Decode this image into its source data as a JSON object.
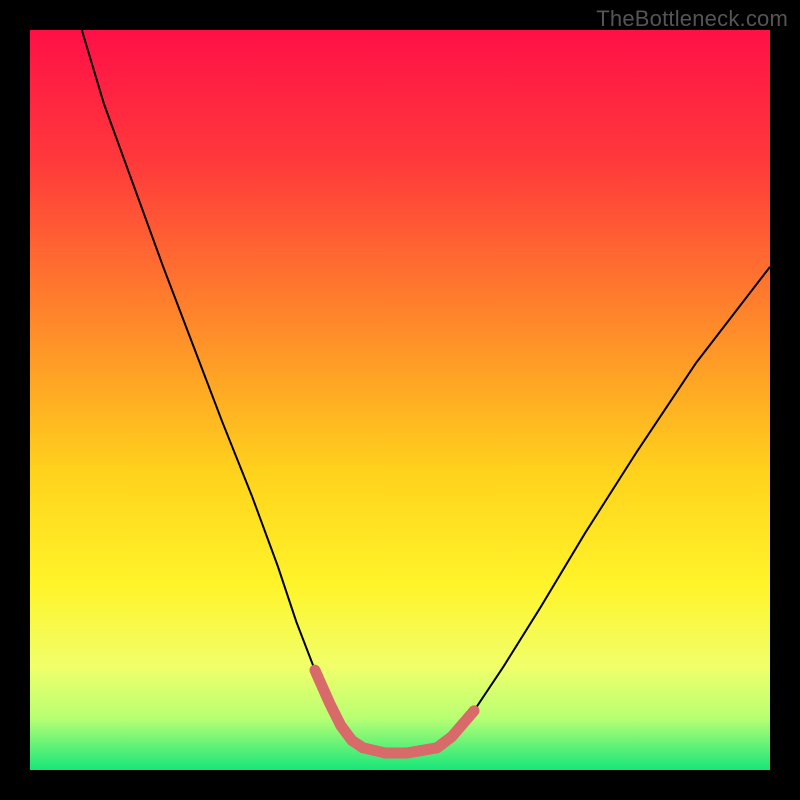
{
  "watermark": "TheBottleneck.com",
  "chart_data": {
    "type": "line",
    "title": "",
    "xlabel": "",
    "ylabel": "",
    "xlim": [
      0,
      100
    ],
    "ylim": [
      0,
      100
    ],
    "gradient_stops": [
      {
        "offset": 0,
        "color": "#ff1047"
      },
      {
        "offset": 18,
        "color": "#ff3a3b"
      },
      {
        "offset": 40,
        "color": "#ff8a2a"
      },
      {
        "offset": 60,
        "color": "#ffd31c"
      },
      {
        "offset": 75,
        "color": "#fff42a"
      },
      {
        "offset": 86,
        "color": "#f1ff6a"
      },
      {
        "offset": 93,
        "color": "#b8ff73"
      },
      {
        "offset": 100,
        "color": "#17e67a"
      }
    ],
    "series": [
      {
        "name": "left-branch",
        "color": "#000000",
        "stroke_width": 2,
        "x": [
          7,
          10,
          14,
          18,
          22,
          26,
          30,
          33.5,
          36,
          38.5,
          40.5,
          42,
          43.5,
          45
        ],
        "y": [
          100,
          90,
          79,
          68,
          57.5,
          47,
          37,
          27.5,
          20,
          13.5,
          9,
          6,
          4,
          3
        ]
      },
      {
        "name": "right-branch",
        "color": "#000000",
        "stroke_width": 2,
        "x": [
          55,
          57,
          60,
          64,
          69,
          75,
          82,
          90,
          100
        ],
        "y": [
          3,
          4.5,
          8,
          14,
          22,
          32,
          43,
          55,
          68
        ]
      },
      {
        "name": "highlight-left",
        "color": "#d86a6a",
        "stroke_width": 11,
        "linecap": "round",
        "x": [
          38.5,
          40.5,
          42,
          43.5,
          45
        ],
        "y": [
          13.5,
          9,
          6,
          4,
          3
        ]
      },
      {
        "name": "highlight-bottom",
        "color": "#d86a6a",
        "stroke_width": 11,
        "linecap": "round",
        "x": [
          45,
          48,
          51,
          55
        ],
        "y": [
          3,
          2.3,
          2.3,
          3
        ]
      },
      {
        "name": "highlight-right",
        "color": "#d86a6a",
        "stroke_width": 11,
        "linecap": "round",
        "x": [
          55,
          57,
          60
        ],
        "y": [
          3,
          4.5,
          8
        ]
      }
    ]
  }
}
